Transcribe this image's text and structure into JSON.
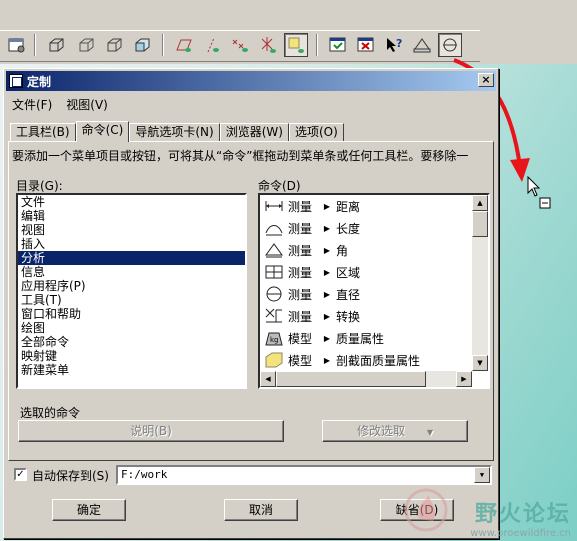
{
  "toolbar": {
    "buttons": [
      {
        "icon": "window-icon"
      },
      {
        "icon": "box-wireframe-icon"
      },
      {
        "icon": "box-hidden-icon"
      },
      {
        "icon": "box-nohidden-icon"
      },
      {
        "icon": "box-shaded-icon"
      },
      {
        "icon": "datum-plane-icon"
      },
      {
        "icon": "datum-axis-icon"
      },
      {
        "icon": "datum-point-icon"
      },
      {
        "icon": "coordinate-system-icon"
      },
      {
        "icon": "annotation-icon"
      },
      {
        "icon": "window-activate-icon"
      },
      {
        "icon": "window-close-icon"
      },
      {
        "icon": "context-help-icon"
      },
      {
        "icon": "measure-icon"
      },
      {
        "icon": "diameter-measure-icon"
      }
    ]
  },
  "dialog": {
    "title": "定制",
    "close_label": "×",
    "menu": [
      "文件(F)",
      "视图(V)"
    ],
    "tabs": [
      "工具栏(B)",
      "命令(C)",
      "导航选项卡(N)",
      "浏览器(W)",
      "选项(O)"
    ],
    "active_tab": "命令(C)",
    "hint": "要添加一个菜单项目或按钮，可将其从“命令”框拖动到菜单条或任何工具栏。要移除一",
    "categories_label": "目录(G):",
    "categories": [
      "文件",
      "编辑",
      "视图",
      "插入",
      "分析",
      "信息",
      "应用程序(P)",
      "工具(T)",
      "窗口和帮助",
      "绘图",
      "全部命令",
      "映射键",
      "新建菜单"
    ],
    "selected_category": "分析",
    "commands_label": "命令(D)",
    "commands": [
      {
        "icon": "distance-icon",
        "group": "测量",
        "name": "距离"
      },
      {
        "icon": "length-icon",
        "group": "测量",
        "name": "长度"
      },
      {
        "icon": "angle-icon",
        "group": "测量",
        "name": "角"
      },
      {
        "icon": "area-icon",
        "group": "测量",
        "name": "区域"
      },
      {
        "icon": "diameter-icon",
        "group": "测量",
        "name": "直径"
      },
      {
        "icon": "transform-icon",
        "group": "测量",
        "name": "转换"
      },
      {
        "icon": "mass-properties-icon",
        "group": "模型",
        "name": "质量属性"
      },
      {
        "icon": "section-mass-icon",
        "group": "模型",
        "name": "剖截面质量属性"
      }
    ],
    "selected_command_label": "选取的命令",
    "describe_button": "说明(B)",
    "modify_selection_button": "修改选取",
    "autosave_label": "自动保存到(S)",
    "autosave_checked": "✓",
    "autosave_path": "F:/work",
    "ok_button": "确定",
    "cancel_button": "取消",
    "default_button": "缺省(D)"
  },
  "watermark": {
    "title": "野火论坛",
    "url": "www.proewildfire.cn"
  },
  "colors": {
    "selection": "#0a246a",
    "arrow": "#e8141a",
    "dialog_bg": "#d4d0c8"
  }
}
